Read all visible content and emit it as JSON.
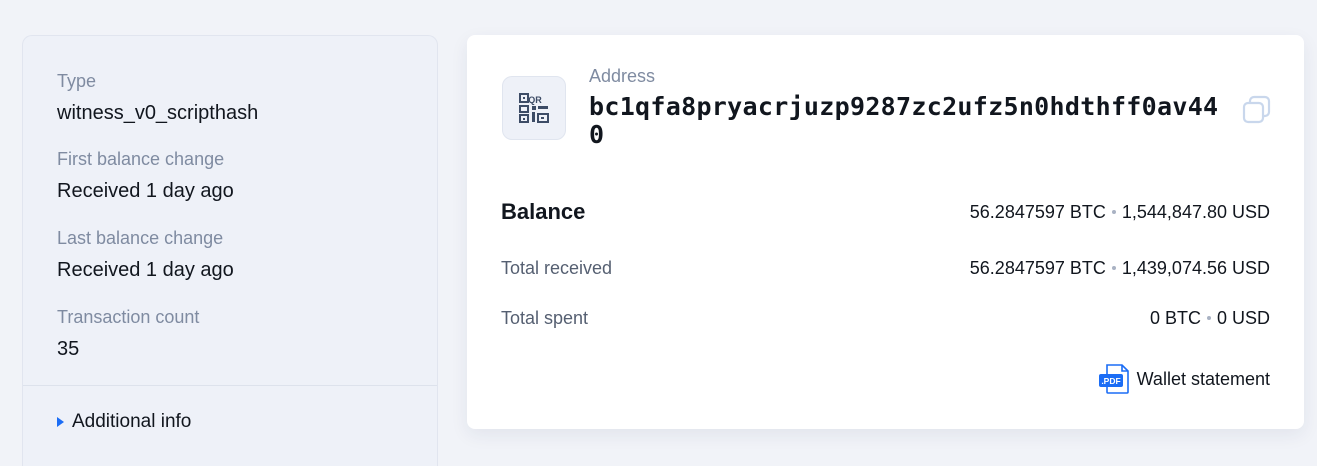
{
  "details": {
    "type_label": "Type",
    "type_value": "witness_v0_scripthash",
    "first_change_label": "First balance change",
    "first_change_value": "Received 1 day ago",
    "last_change_label": "Last balance change",
    "last_change_value": "Received 1 day ago",
    "tx_count_label": "Transaction count",
    "tx_count_value": "35",
    "additional_info_label": "Additional info"
  },
  "address": {
    "label": "Address",
    "value": "bc1qfa8pryacrjuzp9287zc2ufz5n0hdthff0av440",
    "qr_icon": "qr-code-icon",
    "qr_icon_text": "QR",
    "copy_icon": "copy-icon"
  },
  "balance": {
    "label": "Balance",
    "btc": "56.2847597 BTC",
    "usd": "1,544,847.80 USD"
  },
  "total_received": {
    "label": "Total received",
    "btc": "56.2847597 BTC",
    "usd": "1,439,074.56 USD"
  },
  "total_spent": {
    "label": "Total spent",
    "btc": "0 BTC",
    "usd": "0 USD"
  },
  "statement": {
    "label": "Wallet statement",
    "icon": "pdf-icon",
    "icon_text": ".PDF"
  },
  "colors": {
    "accent": "#1b6df5",
    "page_background": "#f1f3f8",
    "panel_background": "#eef1f8",
    "muted_text": "#7f8ba1"
  }
}
